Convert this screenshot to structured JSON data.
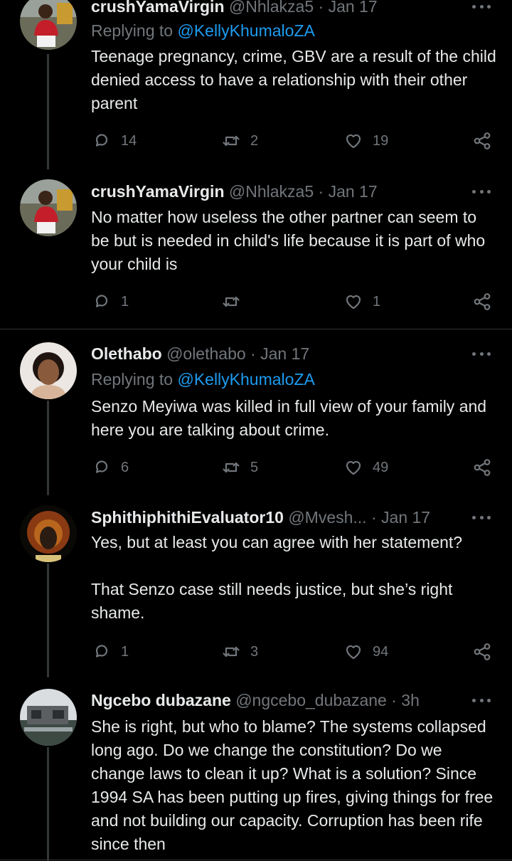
{
  "tweets": [
    {
      "name": "crushYamaVirgin",
      "handle": "@Nhlakza5",
      "sep": " · ",
      "time": "Jan 17",
      "replying_prefix": "Replying to ",
      "replying_to": "@KellyKhumaloZA",
      "text": "Teenage pregnancy, crime, GBV are a result of the child denied access to have a relationship with their other parent",
      "replies": "14",
      "retweets": "2",
      "likes": "19"
    },
    {
      "name": "crushYamaVirgin",
      "handle": "@Nhlakza5",
      "sep": " · ",
      "time": "Jan 17",
      "text": "No matter how useless the other partner can seem to be but is needed in child's life because it is part of who your child is",
      "replies": "1",
      "retweets": "",
      "likes": "1"
    },
    {
      "name": "Olethabo",
      "handle": "@olethabo",
      "sep": " · ",
      "time": "Jan 17",
      "replying_prefix": "Replying to ",
      "replying_to": "@KellyKhumaloZA",
      "text": "Senzo Meyiwa was killed in full view of your family and here you are talking about crime.",
      "replies": "6",
      "retweets": "5",
      "likes": "49"
    },
    {
      "name": "SphithiphithiEvaluator10",
      "handle": "@Mvesh...",
      "sep": " · ",
      "time": "Jan 17",
      "text": "Yes, but at least you can agree with her statement?\n\nThat Senzo case still needs justice, but she’s right shame.",
      "replies": "1",
      "retweets": "3",
      "likes": "94"
    },
    {
      "name": "Ngcebo dubazane",
      "handle": "@ngcebo_dubazane",
      "sep": " · ",
      "time": "3h",
      "text": "She is right, but who to blame? The systems collapsed long ago. Do we change the constitution? Do we change laws to clean it up? What is a solution? Since 1994 SA has been putting up fires, giving things for free and not building our capacity. Corruption has been rife since then"
    }
  ],
  "colors": {
    "background": "#000000",
    "text": "#e7e9ea",
    "muted": "#71767b",
    "link": "#1d9bf0",
    "divider": "#2f3336"
  },
  "icons": {
    "reply": "reply-icon",
    "retweet": "retweet-icon",
    "like": "heart-icon",
    "share": "share-icon",
    "more": "more-icon"
  }
}
